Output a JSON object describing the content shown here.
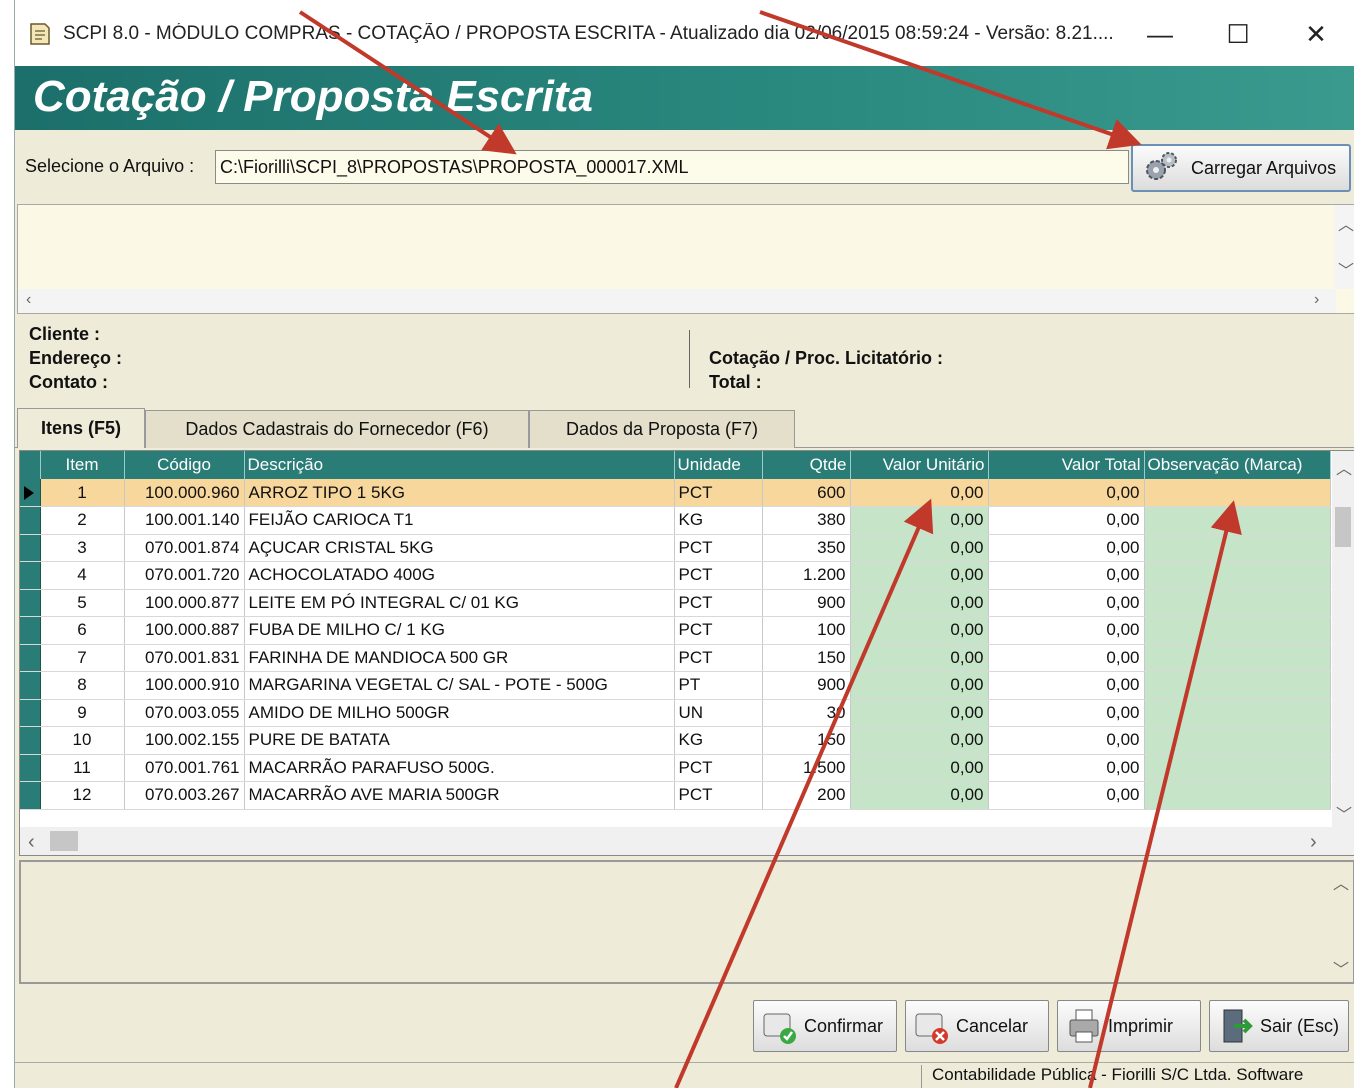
{
  "window": {
    "title": "SCPI 8.0 - MÓDULO COMPRAS - COTAÇÃO / PROPOSTA ESCRITA - Atualizado dia 02/06/2015 08:59:24 - Versão: 8.21....",
    "minimize": "—",
    "maximize": "☐",
    "close": "✕"
  },
  "header": {
    "title": "Cotação / Proposta Escrita"
  },
  "file": {
    "label": "Selecione o Arquivo :",
    "path": "C:\\Fiorilli\\SCPI_8\\PROPOSTAS\\PROPOSTA_000017.XML",
    "load_button": "Carregar Arquivos"
  },
  "info": {
    "cliente": "Cliente :",
    "endereco": "Endereço :",
    "contato": "Contato :",
    "cotacao": "Cotação / Proc. Licitatório :",
    "total": "Total :"
  },
  "tabs": [
    {
      "label": "Itens (F5)",
      "active": true
    },
    {
      "label": "Dados Cadastrais do Fornecedor (F6)",
      "active": false
    },
    {
      "label": "Dados da Proposta (F7)",
      "active": false
    }
  ],
  "grid": {
    "columns": [
      "Item",
      "Código",
      "Descrição",
      "Unidade",
      "Qtde",
      "Valor Unitário",
      "Valor Total",
      "Observação (Marca)"
    ],
    "rows": [
      {
        "item": "1",
        "codigo": "100.000.960",
        "descricao": "ARROZ TIPO 1  5KG",
        "unidade": "PCT",
        "qtde": "600",
        "valor_unitario": "0,00",
        "valor_total": "0,00",
        "observacao": ""
      },
      {
        "item": "2",
        "codigo": "100.001.140",
        "descricao": "FEIJÃO CARIOCA T1",
        "unidade": "KG",
        "qtde": "380",
        "valor_unitario": "0,00",
        "valor_total": "0,00",
        "observacao": ""
      },
      {
        "item": "3",
        "codigo": "070.001.874",
        "descricao": "AÇUCAR CRISTAL 5KG",
        "unidade": "PCT",
        "qtde": "350",
        "valor_unitario": "0,00",
        "valor_total": "0,00",
        "observacao": ""
      },
      {
        "item": "4",
        "codigo": "070.001.720",
        "descricao": "ACHOCOLATADO  400G",
        "unidade": "PCT",
        "qtde": "1.200",
        "valor_unitario": "0,00",
        "valor_total": "0,00",
        "observacao": ""
      },
      {
        "item": "5",
        "codigo": "100.000.877",
        "descricao": "LEITE EM PÓ INTEGRAL C/ 01 KG",
        "unidade": "PCT",
        "qtde": "900",
        "valor_unitario": "0,00",
        "valor_total": "0,00",
        "observacao": ""
      },
      {
        "item": "6",
        "codigo": "100.000.887",
        "descricao": "FUBA DE MILHO C/ 1 KG",
        "unidade": "PCT",
        "qtde": "100",
        "valor_unitario": "0,00",
        "valor_total": "0,00",
        "observacao": ""
      },
      {
        "item": "7",
        "codigo": "070.001.831",
        "descricao": "FARINHA DE MANDIOCA 500 GR",
        "unidade": "PCT",
        "qtde": "150",
        "valor_unitario": "0,00",
        "valor_total": "0,00",
        "observacao": ""
      },
      {
        "item": "8",
        "codigo": "100.000.910",
        "descricao": "MARGARINA VEGETAL C/ SAL - POTE - 500G",
        "unidade": "PT",
        "qtde": "900",
        "valor_unitario": "0,00",
        "valor_total": "0,00",
        "observacao": ""
      },
      {
        "item": "9",
        "codigo": "070.003.055",
        "descricao": "AMIDO DE MILHO 500GR",
        "unidade": "UN",
        "qtde": "30",
        "valor_unitario": "0,00",
        "valor_total": "0,00",
        "observacao": ""
      },
      {
        "item": "10",
        "codigo": "100.002.155",
        "descricao": "PURE DE BATATA",
        "unidade": "KG",
        "qtde": "150",
        "valor_unitario": "0,00",
        "valor_total": "0,00",
        "observacao": ""
      },
      {
        "item": "11",
        "codigo": "070.001.761",
        "descricao": "MACARRÃO PARAFUSO 500G.",
        "unidade": "PCT",
        "qtde": "1.500",
        "valor_unitario": "0,00",
        "valor_total": "0,00",
        "observacao": ""
      },
      {
        "item": "12",
        "codigo": "070.003.267",
        "descricao": "MACARRÃO AVE MARIA 500GR",
        "unidade": "PCT",
        "qtde": "200",
        "valor_unitario": "0,00",
        "valor_total": "0,00",
        "observacao": ""
      }
    ]
  },
  "buttons": {
    "confirmar": "Confirmar",
    "cancelar": "Cancelar",
    "imprimir": "Imprimir",
    "sair": "Sair (Esc)"
  },
  "status": {
    "text": "Contabilidade Pública - Fiorilli S/C Ltda. Software"
  },
  "colors": {
    "header": "#2a8a80",
    "grid_header": "#2a7d77",
    "selected_row": "#f7d79b",
    "editable_cell": "#c6e4c7",
    "annotation_arrow": "#c0392b"
  }
}
